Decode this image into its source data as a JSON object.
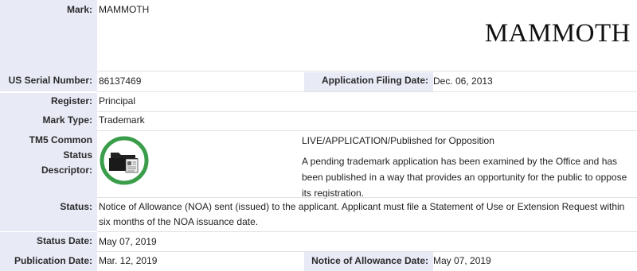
{
  "mark": {
    "label": "Mark:",
    "value": "MAMMOTH",
    "display": "MAMMOTH"
  },
  "serial": {
    "label": "US Serial Number:",
    "value": "86137469"
  },
  "filing": {
    "label": "Application Filing Date:",
    "value": "Dec. 06, 2013"
  },
  "register": {
    "label": "Register:",
    "value": "Principal"
  },
  "mark_type": {
    "label": "Mark Type:",
    "value": "Trademark"
  },
  "tm5": {
    "label_line1": "TM5 Common Status",
    "label_line2": "Descriptor:",
    "icon": "folder-document-icon",
    "icon_color": "#3a9d4a",
    "status_title": "LIVE/APPLICATION/Published for Opposition",
    "description": "A pending trademark application has been examined by the Office and has been published in a way that provides an opportunity for the public to oppose its registration."
  },
  "status": {
    "label": "Status:",
    "value": "Notice of Allowance (NOA) sent (issued) to the applicant. Applicant must file a Statement of Use or Extension Request within six months of the NOA issuance date."
  },
  "status_date": {
    "label": "Status Date:",
    "value": "May 07, 2019"
  },
  "publication": {
    "label": "Publication Date:",
    "value": "Mar. 12, 2019"
  },
  "noa": {
    "label": "Notice of Allowance Date:",
    "value": "May 07, 2019"
  },
  "colors": {
    "label_bg": "#e8eaf6",
    "divider": "#e3e3e3",
    "icon_ring": "#3a9d4a"
  }
}
